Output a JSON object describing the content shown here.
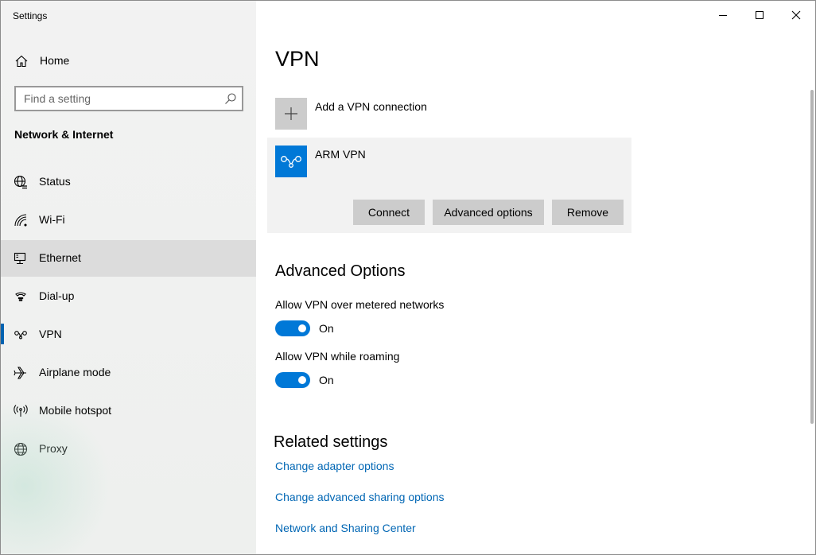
{
  "window": {
    "title": "Settings",
    "controls": {
      "minimize": "minimize",
      "maximize": "maximize",
      "close": "close"
    }
  },
  "sidebar": {
    "home_label": "Home",
    "search": {
      "placeholder": "Find a setting",
      "value": ""
    },
    "section_title": "Network & Internet",
    "items": [
      {
        "label": "Status",
        "icon": "globe-icon"
      },
      {
        "label": "Wi-Fi",
        "icon": "wifi-icon"
      },
      {
        "label": "Ethernet",
        "icon": "ethernet-icon"
      },
      {
        "label": "Dial-up",
        "icon": "dialup-icon"
      },
      {
        "label": "VPN",
        "icon": "vpn-icon"
      },
      {
        "label": "Airplane mode",
        "icon": "airplane-icon"
      },
      {
        "label": "Mobile hotspot",
        "icon": "hotspot-icon"
      },
      {
        "label": "Proxy",
        "icon": "globe-icon"
      }
    ],
    "hovered_item": "Ethernet",
    "active_item": "VPN"
  },
  "main": {
    "title": "VPN",
    "add_connection_label": "Add a VPN connection",
    "connection": {
      "name": "ARM VPN",
      "buttons": {
        "connect": "Connect",
        "advanced": "Advanced options",
        "remove": "Remove"
      }
    },
    "advanced_options": {
      "heading": "Advanced Options",
      "metered": {
        "label": "Allow VPN over metered networks",
        "state": "On"
      },
      "roaming": {
        "label": "Allow VPN while roaming",
        "state": "On"
      }
    },
    "related": {
      "heading": "Related settings",
      "links": [
        "Change adapter options",
        "Change advanced sharing options",
        "Network and Sharing Center"
      ]
    }
  },
  "colors": {
    "accent": "#0078d7",
    "link": "#0066b4",
    "sidebar_bg": "#f2f2f2",
    "selected_bg": "#dcdcdc"
  }
}
